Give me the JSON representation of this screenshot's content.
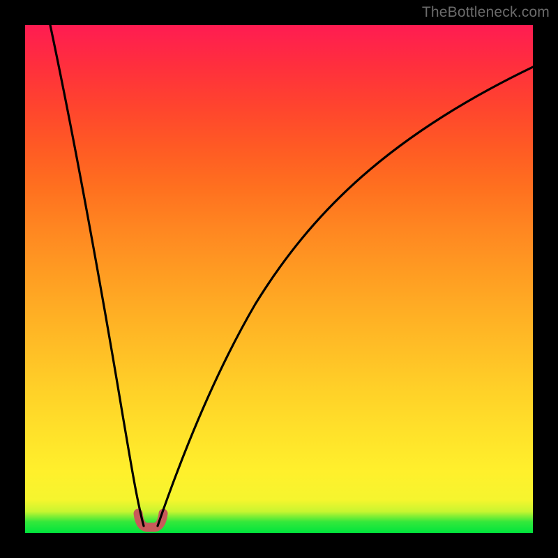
{
  "branding": {
    "text": "TheBottleneck.com"
  },
  "chart_data": {
    "type": "line",
    "title": "",
    "xlabel": "",
    "ylabel": "",
    "xlim": [
      0,
      100
    ],
    "ylim": [
      0,
      100
    ],
    "grid": false,
    "legend": false,
    "annotations": [],
    "series": [
      {
        "name": "left-branch",
        "color": "#000000",
        "x": [
          5,
          8,
          12,
          15,
          18,
          20,
          22,
          23
        ],
        "y": [
          100,
          78,
          52,
          35,
          19,
          9,
          3,
          1
        ]
      },
      {
        "name": "right-branch",
        "color": "#000000",
        "x": [
          26,
          28,
          31,
          35,
          40,
          46,
          53,
          61,
          70,
          80,
          90,
          100
        ],
        "y": [
          1,
          5,
          14,
          27,
          40,
          52,
          62,
          71,
          78,
          84,
          89,
          92
        ]
      },
      {
        "name": "trough-marker",
        "color": "#c85a5a",
        "x": [
          22.5,
          23.5,
          24.5,
          25.5,
          26.5
        ],
        "y": [
          3.5,
          1.2,
          0.9,
          1.3,
          3.6
        ]
      }
    ],
    "background_gradient": {
      "direction": "vertical",
      "stops": [
        {
          "pos": 0.0,
          "color": "#00e53c"
        },
        {
          "pos": 0.03,
          "color": "#7eee35"
        },
        {
          "pos": 0.06,
          "color": "#f5f52e"
        },
        {
          "pos": 0.2,
          "color": "#ffe12a"
        },
        {
          "pos": 0.44,
          "color": "#ffad24"
        },
        {
          "pos": 0.68,
          "color": "#ff701f"
        },
        {
          "pos": 0.84,
          "color": "#ff442e"
        },
        {
          "pos": 1.0,
          "color": "#ff1c52"
        }
      ]
    }
  }
}
